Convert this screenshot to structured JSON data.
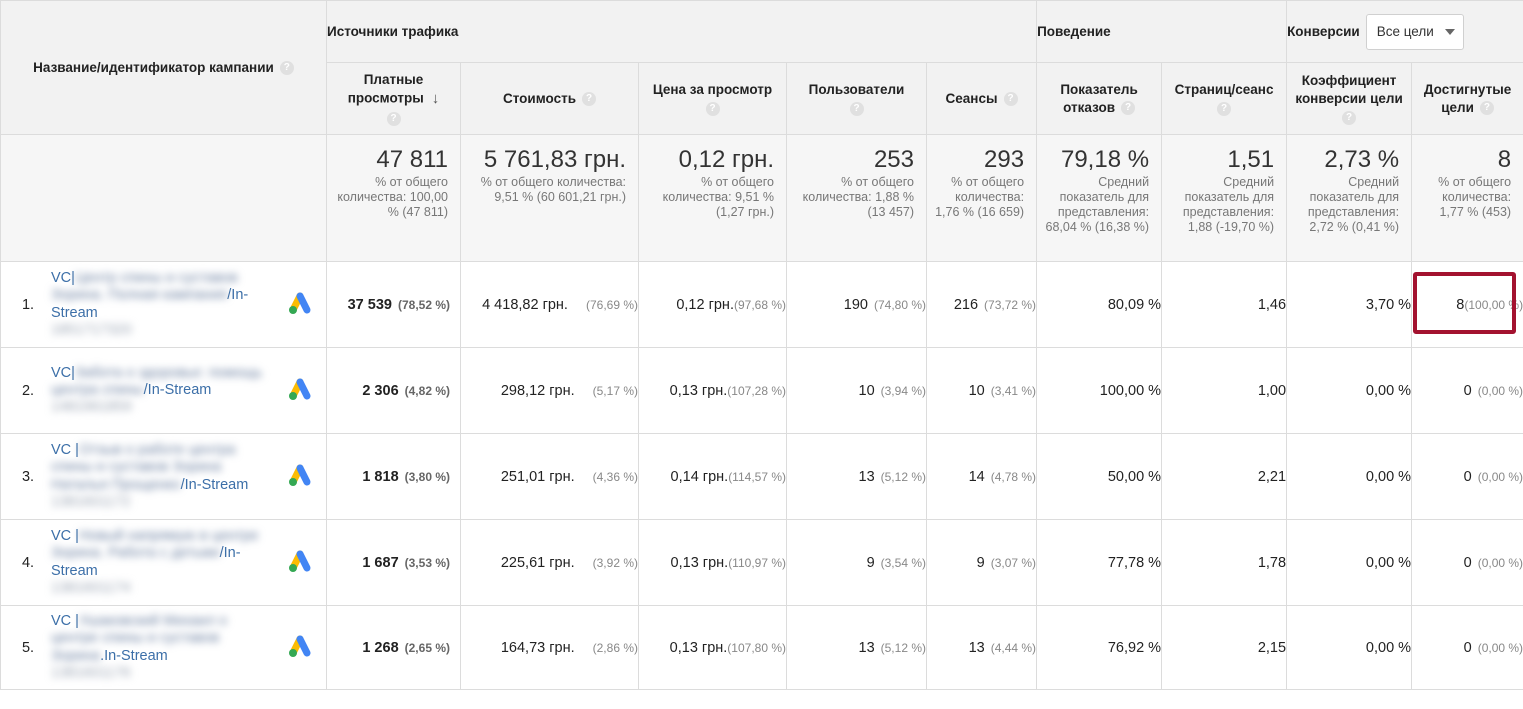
{
  "header": {
    "campaign_title": "Название/идентификатор кампании",
    "help_glyph": "?",
    "groups": {
      "traffic": "Источники трафика",
      "behavior": "Поведение",
      "conversions": "Конверсии"
    },
    "goal_select": {
      "value": "Все цели"
    },
    "columns": {
      "views": "Платные просмотры",
      "cost": "Стоимость",
      "cpv": "Цена за просмотр",
      "users": "Пользователи",
      "sessions": "Сеансы",
      "bounce": "Показатель отказов",
      "pages": "Страниц/сеанс",
      "conv_rate": "Коэффициент конверсии цели",
      "goals": "Достигнутые цели"
    }
  },
  "totals": {
    "views": {
      "value": "47 811",
      "note": "% от общего количества: 100,00 % (47 811)"
    },
    "cost": {
      "value": "5 761,83 грн.",
      "note": "% от общего количества: 9,51 % (60 601,21 грн.)"
    },
    "cpv": {
      "value": "0,12 грн.",
      "note": "% от общего количества: 9,51 % (1,27 грн.)"
    },
    "users": {
      "value": "253",
      "note": "% от общего количества: 1,88 % (13 457)"
    },
    "sessions": {
      "value": "293",
      "note": "% от общего количества: 1,76 % (16 659)"
    },
    "bounce": {
      "value": "79,18 %",
      "note": "Средний показатель для представления: 68,04 % (16,38 %)"
    },
    "pages": {
      "value": "1,51",
      "note": "Средний показатель для представления: 1,88 (-19,70 %)"
    },
    "conv_rate": {
      "value": "2,73 %",
      "note": "Средний показатель для представления: 2,72 % (0,41 %)"
    },
    "goals": {
      "value": "8",
      "note": "% от общего количества: 1,77 % (453)"
    }
  },
  "rows": [
    {
      "index": "1.",
      "name_visible_start": "VC|",
      "name_blurred": "Центр спины и суставов Зорина. Полная кампания",
      "name_visible_end": "/In-Stream",
      "id_blurred": "1851717320",
      "icon": "google-ads-icon",
      "views": "37 539",
      "views_pct": "(78,52 %)",
      "cost": "4 418,82 грн.",
      "cost_pct": "(76,69 %)",
      "cpv": "0,12 грн.",
      "cpv_pct": "(97,68 %)",
      "users": "190",
      "users_pct": "(74,80 %)",
      "sessions": "216",
      "sessions_pct": "(73,72 %)",
      "bounce": "80,09 %",
      "pages": "1,46",
      "conv_rate": "3,70 %",
      "goals": "8",
      "goals_pct": "(100,00 %)"
    },
    {
      "index": "2.",
      "name_visible_start": "VC|",
      "name_blurred": "Забота о здоровье: помощь центра спины",
      "name_visible_end": "/In-Stream",
      "id_blurred": "1481961859",
      "icon": "google-ads-icon",
      "views": "2 306",
      "views_pct": "(4,82 %)",
      "cost": "298,12 грн.",
      "cost_pct": "(5,17 %)",
      "cpv": "0,13 грн.",
      "cpv_pct": "(107,28 %)",
      "users": "10",
      "users_pct": "(3,94 %)",
      "sessions": "10",
      "sessions_pct": "(3,41 %)",
      "bounce": "100,00 %",
      "pages": "1,00",
      "conv_rate": "0,00 %",
      "goals": "0",
      "goals_pct": "(0,00 %)"
    },
    {
      "index": "3.",
      "name_visible_start": "VC |",
      "name_blurred": "Отзыв о работе центра спины и суставов Зорина Наталья Прощенко",
      "name_visible_end": "/In-Stream",
      "id_blurred": "1381601172",
      "icon": "google-ads-icon",
      "views": "1 818",
      "views_pct": "(3,80 %)",
      "cost": "251,01 грн.",
      "cost_pct": "(4,36 %)",
      "cpv": "0,14 грн.",
      "cpv_pct": "(114,57 %)",
      "users": "13",
      "users_pct": "(5,12 %)",
      "sessions": "14",
      "sessions_pct": "(4,78 %)",
      "bounce": "50,00 %",
      "pages": "2,21",
      "conv_rate": "0,00 %",
      "goals": "0",
      "goals_pct": "(0,00 %)"
    },
    {
      "index": "4.",
      "name_visible_start": "VC |",
      "name_blurred": "Новый напрямую в центре Зорина. Работа с детьми",
      "name_visible_end": "/In-Stream",
      "id_blurred": "1381601174",
      "icon": "google-ads-icon",
      "views": "1 687",
      "views_pct": "(3,53 %)",
      "cost": "225,61 грн.",
      "cost_pct": "(3,92 %)",
      "cpv": "0,13 грн.",
      "cpv_pct": "(110,97 %)",
      "users": "9",
      "users_pct": "(3,54 %)",
      "sessions": "9",
      "sessions_pct": "(3,07 %)",
      "bounce": "77,78 %",
      "pages": "1,78",
      "conv_rate": "0,00 %",
      "goals": "0",
      "goals_pct": "(0,00 %)"
    },
    {
      "index": "5.",
      "name_visible_start": "VC |",
      "name_blurred": "Ушаковский Михаил о центре спины и суставов Зорина",
      "name_visible_end": ".In-Stream",
      "id_blurred": "1381601176",
      "icon": "google-ads-icon",
      "views": "1 268",
      "views_pct": "(2,65 %)",
      "cost": "164,73 грн.",
      "cost_pct": "(2,86 %)",
      "cpv": "0,13 грн.",
      "cpv_pct": "(107,80 %)",
      "users": "13",
      "users_pct": "(5,12 %)",
      "sessions": "13",
      "sessions_pct": "(4,44 %)",
      "bounce": "76,92 %",
      "pages": "2,15",
      "conv_rate": "0,00 %",
      "goals": "0",
      "goals_pct": "(0,00 %)"
    }
  ],
  "colors": {
    "highlight_border": "#a3122f",
    "link": "#3c6fa8",
    "header_bg": "#f2f2f2",
    "ads_blue": "#4285F4",
    "ads_yellow": "#FBBC04",
    "ads_green": "#34A853"
  }
}
